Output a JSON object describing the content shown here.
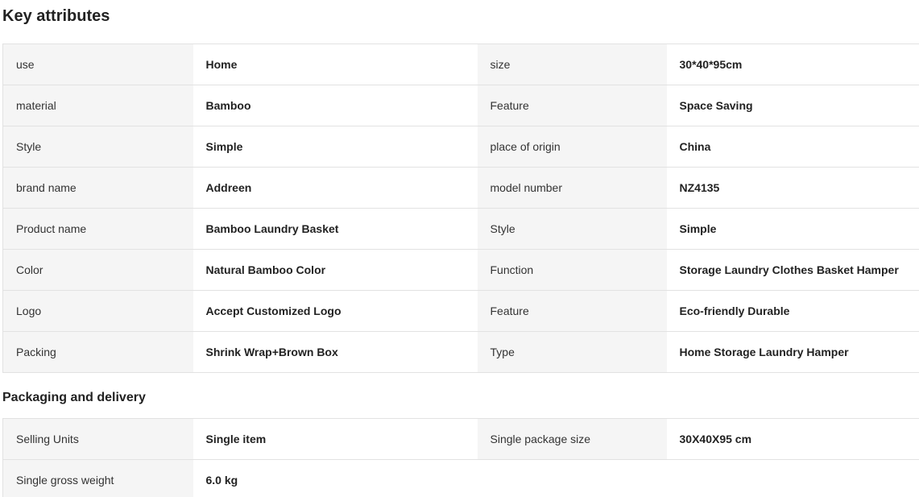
{
  "key_attributes": {
    "title": "Key attributes",
    "rows": [
      {
        "l1": "use",
        "v1": "Home",
        "l2": "size",
        "v2": "30*40*95cm"
      },
      {
        "l1": "material",
        "v1": "Bamboo",
        "l2": "Feature",
        "v2": "Space Saving"
      },
      {
        "l1": "Style",
        "v1": "Simple",
        "l2": "place of origin",
        "v2": "China"
      },
      {
        "l1": "brand name",
        "v1": "Addreen",
        "l2": "model number",
        "v2": "NZ4135"
      },
      {
        "l1": "Product name",
        "v1": "Bamboo Laundry Basket",
        "l2": "Style",
        "v2": "Simple"
      },
      {
        "l1": "Color",
        "v1": "Natural Bamboo Color",
        "l2": "Function",
        "v2": "Storage Laundry Clothes Basket Hamper"
      },
      {
        "l1": "Logo",
        "v1": "Accept Customized Logo",
        "l2": "Feature",
        "v2": "Eco-friendly Durable"
      },
      {
        "l1": "Packing",
        "v1": "Shrink Wrap+Brown Box",
        "l2": "Type",
        "v2": "Home Storage Laundry Hamper"
      }
    ]
  },
  "packaging": {
    "title": "Packaging and delivery",
    "rows": [
      {
        "l1": "Selling Units",
        "v1": "Single item",
        "l2": "Single package size",
        "v2": "30X40X95 cm"
      },
      {
        "l1": "Single gross weight",
        "v1": "6.0 kg",
        "l2": "",
        "v2": ""
      }
    ]
  },
  "colors": {
    "label_bg": "#f5f5f5",
    "border": "#e2e2e2",
    "text": "#222222"
  }
}
